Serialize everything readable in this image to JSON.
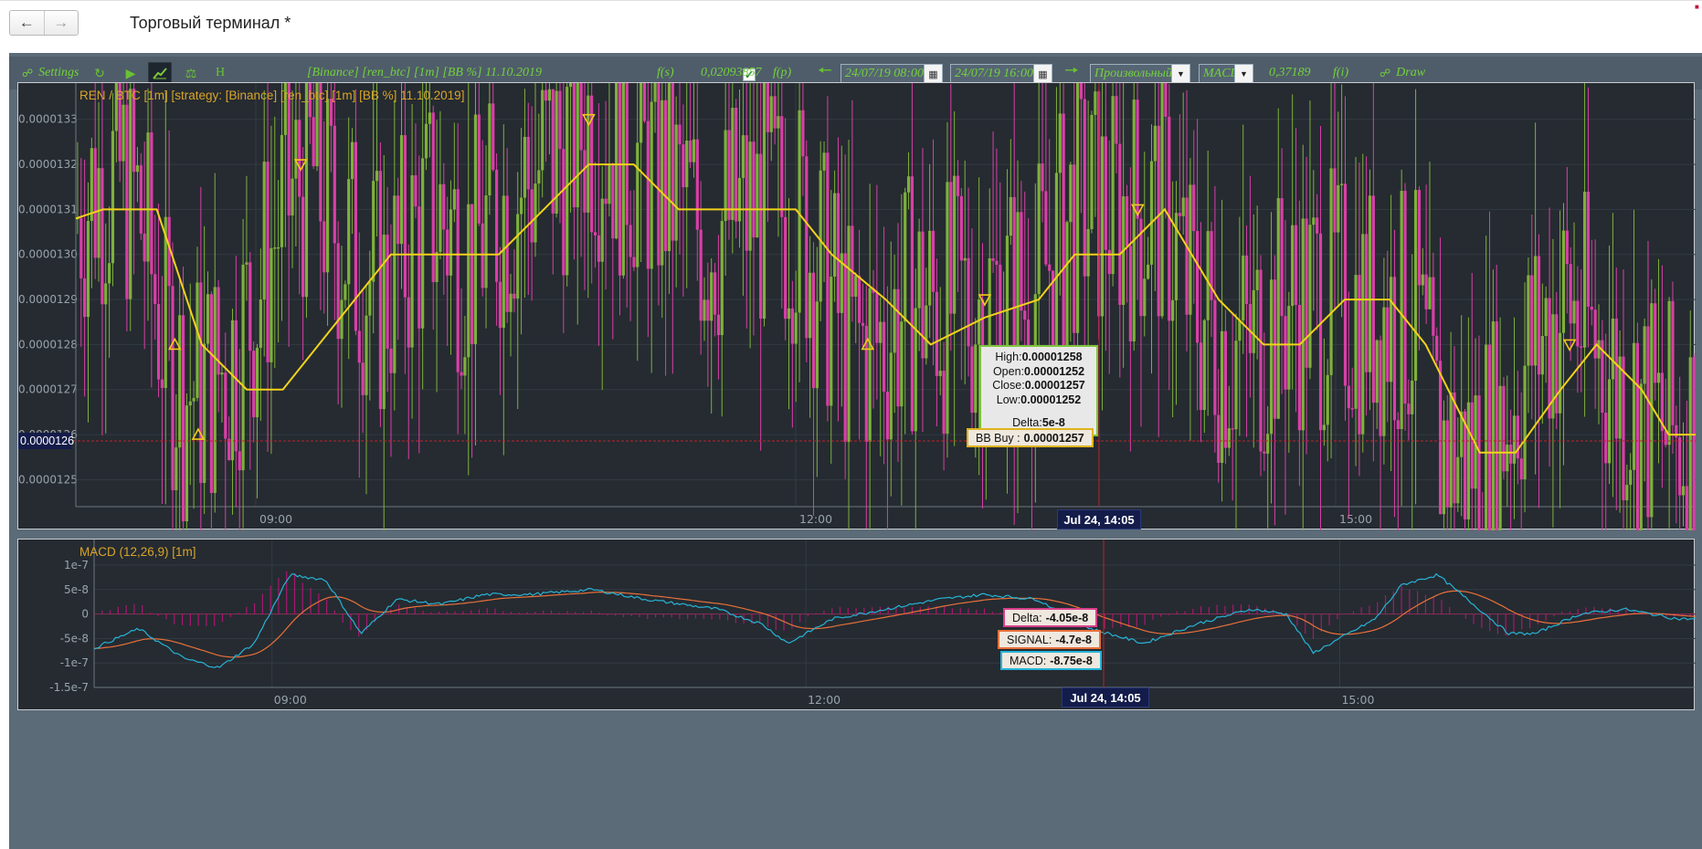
{
  "window": {
    "title": "Торговый терминал *",
    "back_icon": "arrow-left-icon",
    "forward_icon": "arrow-right-icon"
  },
  "toolbar": {
    "settings_label": "Settings",
    "refresh_icon": "refresh-icon",
    "play_icon": "play-icon",
    "chart_icon": "chart-icon",
    "scales_icon": "scales-icon",
    "h_label": "H",
    "strategy_label": "[Binance] [ren_btc] [1m] [BB %] 11.10.2019",
    "checkbox_checked": true,
    "fs_label": "f(s)",
    "value_label": "0,02093857",
    "fp_label": "f(p)",
    "date_from": "24/07/19 08:00",
    "date_to": "24/07/19 16:00",
    "mode_select": "Произвольный",
    "indicator_select": "MACD",
    "indicator_value": "0,37189",
    "fi_label": "f(i)",
    "draw_label": "Draw"
  },
  "main_chart": {
    "title": "REN / BTC [1m] [strategy: [Binance] [ren_btc] [1m] [BB %] 11.10.2019]",
    "crosshair_y_label": "0.0000126",
    "crosshair_x_label": "Jul 24, 14:05",
    "tooltip": {
      "high_label": "High:",
      "high": "0.00001258",
      "open_label": "Open:",
      "open": "0.00001252",
      "close_label": "Close:",
      "close": "0.00001257",
      "low_label": "Low:",
      "low": "0.00001252",
      "delta_label": "Delta:",
      "delta": "5e-8"
    },
    "bb_label": "BB Buy :",
    "bb_value": "0.00001257"
  },
  "macd_chart": {
    "title": "MACD (12,26,9) [1m]",
    "crosshair_x_label": "Jul 24, 14:05",
    "delta_label": "Delta:",
    "delta_value": "-4.05e-8",
    "signal_label": "SIGNAL:",
    "signal_value": "-4.7e-8",
    "macd_label": "MACD:",
    "macd_value": "-8.75e-8"
  },
  "colors": {
    "bull_candle": "#7fb03c",
    "bear_candle": "#d93fa7",
    "strategy_line": "#f3d21a",
    "macd_line": "#27b3d6",
    "signal_line": "#e8703a",
    "histogram": "#c0147c",
    "accent_green": "#73d13d"
  },
  "chart_data": [
    {
      "type": "line",
      "name": "REN / BTC candles",
      "ylim": [
        1.244e-05,
        1.334e-05
      ],
      "y_ticks": [
        "0.0000133",
        "0.0000132",
        "0.0000131",
        "0.0000130",
        "0.0000129",
        "0.0000128",
        "0.0000127",
        "0.0000126",
        "0.0000125"
      ],
      "y_tick_values": [
        1.33e-05,
        1.32e-05,
        1.31e-05,
        1.3e-05,
        1.29e-05,
        1.28e-05,
        1.27e-05,
        1.26e-05,
        1.25e-05
      ],
      "x_ticks": [
        "09:00",
        "12:00",
        "15:00"
      ],
      "x_tick_hours": [
        9,
        12,
        15
      ],
      "xlim_hours": [
        8.0,
        16.0
      ],
      "price_anchors": [
        [
          8.0,
          1.308e-05
        ],
        [
          8.1,
          1.315e-05
        ],
        [
          8.25,
          1.318e-05
        ],
        [
          8.35,
          1.31e-05
        ],
        [
          8.5,
          1.28e-05
        ],
        [
          8.6,
          1.27e-05
        ],
        [
          8.7,
          1.27e-05
        ],
        [
          8.85,
          1.276e-05
        ],
        [
          9.0,
          1.29e-05
        ],
        [
          9.15,
          1.31e-05
        ],
        [
          9.3,
          1.32e-05
        ],
        [
          9.4,
          1.31e-05
        ],
        [
          9.55,
          1.3e-05
        ],
        [
          9.7,
          1.29e-05
        ],
        [
          9.85,
          1.302e-05
        ],
        [
          10.0,
          1.31e-05
        ],
        [
          10.2,
          1.3e-05
        ],
        [
          10.35,
          1.31e-05
        ],
        [
          10.6,
          1.32e-05
        ],
        [
          10.85,
          1.33e-05
        ],
        [
          11.0,
          1.325e-05
        ],
        [
          11.3,
          1.315e-05
        ],
        [
          11.5,
          1.305e-05
        ],
        [
          11.75,
          1.31e-05
        ],
        [
          12.0,
          1.31e-05
        ],
        [
          12.1,
          1.3e-05
        ],
        [
          12.3,
          1.28e-05
        ],
        [
          12.45,
          1.28e-05
        ],
        [
          12.65,
          1.29e-05
        ],
        [
          12.9,
          1.288e-05
        ],
        [
          13.1,
          1.29e-05
        ],
        [
          13.3,
          1.29e-05
        ],
        [
          13.55,
          1.31e-05
        ],
        [
          13.8,
          1.31e-05
        ],
        [
          14.05,
          1.31e-05
        ],
        [
          14.2,
          1.29e-05
        ],
        [
          14.4,
          1.28e-05
        ],
        [
          14.55,
          1.28e-05
        ],
        [
          14.75,
          1.29e-05
        ],
        [
          15.0,
          1.29e-05
        ],
        [
          15.2,
          1.288e-05
        ],
        [
          15.45,
          1.285e-05
        ],
        [
          15.55,
          1.26e-05
        ],
        [
          15.7,
          1.255e-05
        ],
        [
          15.9,
          1.26e-05
        ],
        [
          16.1,
          1.28e-05
        ],
        [
          16.3,
          1.29e-05
        ],
        [
          16.45,
          1.28e-05
        ],
        [
          16.6,
          1.27e-05
        ],
        [
          16.85,
          1.26e-05
        ],
        [
          17.0,
          1.26e-05
        ]
      ],
      "strategy_line_steps": [
        [
          8.0,
          1.308e-05
        ],
        [
          8.15,
          1.31e-05
        ],
        [
          8.45,
          1.31e-05
        ],
        [
          8.7,
          1.28e-05
        ],
        [
          8.95,
          1.27e-05
        ],
        [
          9.15,
          1.27e-05
        ],
        [
          9.55,
          1.29e-05
        ],
        [
          9.75,
          1.3e-05
        ],
        [
          9.95,
          1.3e-05
        ],
        [
          10.1,
          1.3e-05
        ],
        [
          10.35,
          1.3e-05
        ],
        [
          10.6,
          1.31e-05
        ],
        [
          10.85,
          1.32e-05
        ],
        [
          11.1,
          1.32e-05
        ],
        [
          11.35,
          1.31e-05
        ],
        [
          11.65,
          1.31e-05
        ],
        [
          12.0,
          1.31e-05
        ],
        [
          12.2,
          1.3e-05
        ],
        [
          12.5,
          1.29e-05
        ],
        [
          12.75,
          1.28e-05
        ],
        [
          13.05,
          1.286e-05
        ],
        [
          13.35,
          1.29e-05
        ],
        [
          13.55,
          1.3e-05
        ],
        [
          13.8,
          1.3e-05
        ],
        [
          14.05,
          1.31e-05
        ],
        [
          14.35,
          1.29e-05
        ],
        [
          14.6,
          1.28e-05
        ],
        [
          14.8,
          1.28e-05
        ],
        [
          15.05,
          1.29e-05
        ],
        [
          15.3,
          1.29e-05
        ],
        [
          15.5,
          1.28e-05
        ],
        [
          15.8,
          1.256e-05
        ],
        [
          16.0,
          1.256e-05
        ],
        [
          16.25,
          1.27e-05
        ],
        [
          16.45,
          1.28e-05
        ],
        [
          16.7,
          1.27e-05
        ],
        [
          16.85,
          1.26e-05
        ],
        [
          17.0,
          1.26e-05
        ]
      ]
    },
    {
      "type": "line",
      "name": "MACD (12,26,9)",
      "ylim": [
        -1.5e-07,
        1e-07
      ],
      "y_ticks": [
        "1e-7",
        "5e-8",
        "0",
        "-5e-8",
        "-1e-7",
        "-1.5e-7"
      ],
      "y_tick_values": [
        1e-07,
        5e-08,
        0,
        -5e-08,
        -1e-07,
        -1.5e-07
      ],
      "x_ticks": [
        "09:00",
        "12:00",
        "15:00"
      ],
      "x_tick_hours": [
        9,
        12,
        15
      ],
      "xlim_hours": [
        8.0,
        16.0
      ],
      "macd_anchors": [
        [
          8.0,
          -7e-08
        ],
        [
          8.25,
          -3e-08
        ],
        [
          8.5,
          -9e-08
        ],
        [
          8.7,
          -1.1e-07
        ],
        [
          8.9,
          -6e-08
        ],
        [
          9.1,
          8e-08
        ],
        [
          9.3,
          7e-08
        ],
        [
          9.5,
          -4e-08
        ],
        [
          9.7,
          3e-08
        ],
        [
          9.95,
          2e-08
        ],
        [
          10.2,
          4e-08
        ],
        [
          10.45,
          4e-08
        ],
        [
          10.8,
          5e-08
        ],
        [
          11.1,
          3e-08
        ],
        [
          11.5,
          1e-08
        ],
        [
          11.75,
          -2e-08
        ],
        [
          11.9,
          -6e-08
        ],
        [
          12.15,
          -1e-08
        ],
        [
          12.45,
          1e-08
        ],
        [
          12.75,
          3e-08
        ],
        [
          13.0,
          4e-08
        ],
        [
          13.3,
          3e-08
        ],
        [
          13.6,
          -3e-08
        ],
        [
          13.9,
          -6e-08
        ],
        [
          14.2,
          -2e-08
        ],
        [
          14.5,
          1e-08
        ],
        [
          14.7,
          0.0
        ],
        [
          14.85,
          -8e-08
        ],
        [
          15.0,
          -5e-08
        ],
        [
          15.2,
          -1e-08
        ],
        [
          15.35,
          6e-08
        ],
        [
          15.55,
          8e-08
        ],
        [
          15.75,
          2e-08
        ],
        [
          15.95,
          -4e-08
        ],
        [
          16.1,
          -4e-08
        ],
        [
          16.35,
          0.0
        ],
        [
          16.6,
          1e-08
        ],
        [
          16.9,
          -1e-08
        ],
        [
          17.0,
          -1e-08
        ]
      ]
    }
  ]
}
